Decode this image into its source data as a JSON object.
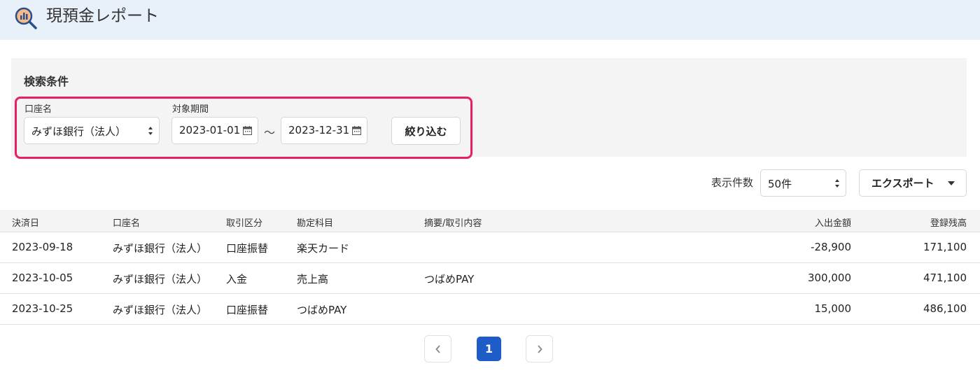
{
  "header": {
    "title": "現預金レポート",
    "icon": "report-search-icon"
  },
  "search": {
    "title": "検索条件",
    "account_label": "口座名",
    "account_value": "みずほ銀行（法人）",
    "period_label": "対象期間",
    "date_from": "2023-01-01",
    "date_separator": "～",
    "date_to": "2023-12-31",
    "filter_button": "絞り込む",
    "highlight_color": "#ea1f63"
  },
  "toolbar": {
    "count_label": "表示件数",
    "count_value": "50件",
    "export_button": "エクスポート"
  },
  "table": {
    "columns": [
      "決済日",
      "口座名",
      "取引区分",
      "勘定科目",
      "摘要/取引内容",
      "入出金額",
      "登録残高"
    ],
    "rows": [
      {
        "date": "2023-09-18",
        "account": "みずほ銀行（法人）",
        "type": "口座振替",
        "category": "楽天カード",
        "memo": "",
        "amount": "-28,900",
        "balance": "171,100"
      },
      {
        "date": "2023-10-05",
        "account": "みずほ銀行（法人）",
        "type": "入金",
        "category": "売上高",
        "memo": "つばめPAY",
        "amount": "300,000",
        "balance": "471,100"
      },
      {
        "date": "2023-10-25",
        "account": "みずほ銀行（法人）",
        "type": "口座振替",
        "category": "つばめPAY",
        "memo": "",
        "amount": "15,000",
        "balance": "486,100"
      }
    ]
  },
  "pagination": {
    "current_page": "1",
    "accent": "#1e5cc8"
  }
}
